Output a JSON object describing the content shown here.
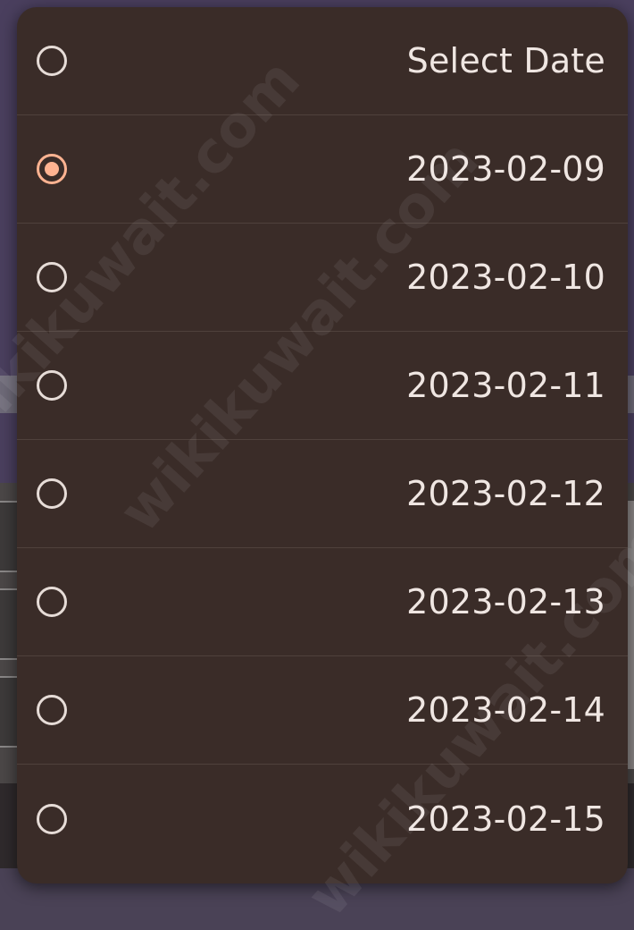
{
  "watermark_text": "wikikuwait.com",
  "dropdown": {
    "options": [
      {
        "label": "Select Date",
        "selected": false
      },
      {
        "label": "2023-02-09",
        "selected": true
      },
      {
        "label": "2023-02-10",
        "selected": false
      },
      {
        "label": "2023-02-11",
        "selected": false
      },
      {
        "label": "2023-02-12",
        "selected": false
      },
      {
        "label": "2023-02-13",
        "selected": false
      },
      {
        "label": "2023-02-14",
        "selected": false
      },
      {
        "label": "2023-02-15",
        "selected": false
      }
    ]
  },
  "colors": {
    "dropdown_background": "#3a2c28",
    "selected_accent": "#ffb391",
    "text": "#efe6e2"
  }
}
